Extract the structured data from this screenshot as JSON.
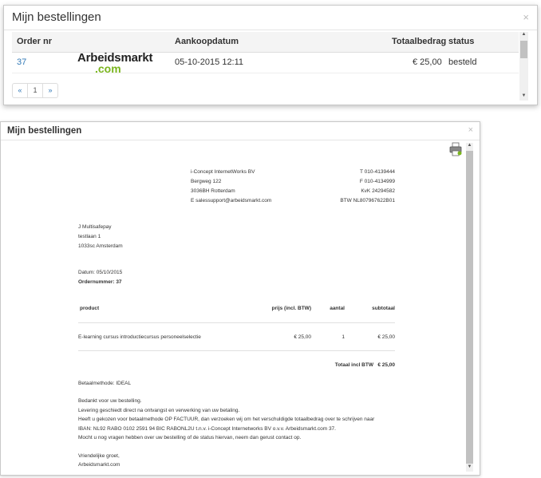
{
  "orders_modal": {
    "title": "Mijn bestellingen",
    "close": "×",
    "columns": [
      "Order nr",
      "Aankoopdatum",
      "Totaalbedrag",
      "status"
    ],
    "rows": [
      {
        "order_nr": "37",
        "date": "05-10-2015 12:11",
        "total": "€ 25,00",
        "status": "besteld"
      }
    ],
    "pagination": {
      "prev": "«",
      "page": "1",
      "next": "»"
    }
  },
  "invoice_modal": {
    "title": "Mijn bestellingen",
    "close": "×",
    "company": {
      "logo_top": "Arbeidsmarkt",
      "logo_bottom": ".com",
      "name": "i-Concept InternetWorks BV",
      "street": "Bergweg 122",
      "city": "3036BH Rotterdam",
      "email": "E salessupport@arbeidsmarkt.com",
      "phone": "T 010-4139444",
      "fax": "F 010-4134999",
      "kvk": "KvK 24294582",
      "btw": "BTW NL807967622B01"
    },
    "customer": {
      "name": "J Multisafepay",
      "street": "testlaan 1",
      "city": "1033sc Amsterdam"
    },
    "date_line": "Datum: 05/10/2015",
    "order_line": "Ordernummer: 37",
    "table": {
      "headers": [
        "product",
        "prijs (incl. BTW)",
        "aantal",
        "subtotaal"
      ],
      "row": {
        "product": "E-learning cursus introductiecursus personeelselectie",
        "price": "€ 25,00",
        "qty": "1",
        "subtotal": "€ 25,00"
      },
      "total_label": "Totaal incl BTW",
      "total_value": "€ 25,00"
    },
    "payment_method": "Betaalmethode: IDEAL",
    "paragraphs": [
      "Bedankt voor uw bestelling.",
      "Levering geschiedt direct na ontvangst en verwerking van uw betaling.",
      "Heeft u gekozen voor betaalmethode OP FACTUUR, dan verzoeken wij om het verschuldigde totaalbedrag over te schrijven naar",
      "IBAN: NL92 RABO 0102 2591 94 BIC RABONL2U t.n.v. i-Concept Internetworks BV o.v.v. Arbeidsmarkt.com 37.",
      "Mocht u nog vragen hebben over uw bestelling of de status hiervan, neem dan gerust contact op."
    ],
    "closing": "Vriendelijke groet,",
    "signature": "Arbeidsmarkt.com"
  },
  "colors": {
    "link": "#337ab7",
    "logo_green": "#7ab51d"
  }
}
